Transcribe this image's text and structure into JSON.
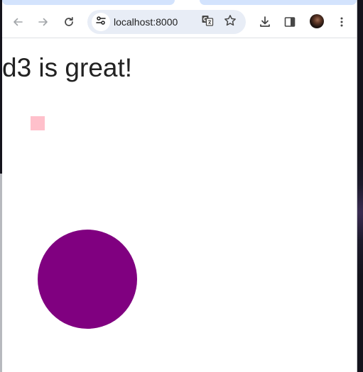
{
  "browser": {
    "address": "localhost:8000",
    "icons": {
      "back": "arrow-left-icon",
      "forward": "arrow-right-icon",
      "reload": "reload-icon",
      "site_info": "tune-icon",
      "translate": "translate-icon",
      "bookmark": "star-icon",
      "download": "download-icon",
      "side_panel": "side-panel-icon",
      "menu": "kebab-menu-icon"
    }
  },
  "page": {
    "heading": "d3 is great!",
    "shapes": {
      "square": {
        "fill": "#ffc0cb",
        "shape": "rect"
      },
      "circle": {
        "fill": "#800080",
        "shape": "circle"
      }
    }
  },
  "colors": {
    "tab_active": "#d3e3fd",
    "omnibox": "#e8edf6",
    "toolbar_icon": "#474747"
  }
}
